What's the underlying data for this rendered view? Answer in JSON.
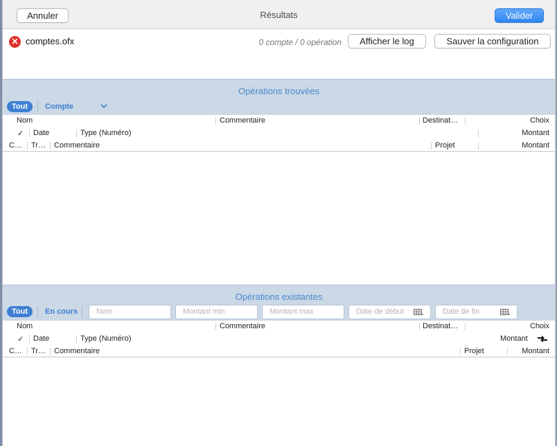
{
  "toolbar": {
    "cancel_label": "Annuler",
    "title": "Résultats",
    "validate_label": "Valider"
  },
  "file": {
    "name": "comptes.ofx",
    "status_icon": "error-icon",
    "count_text": "0 compte / 0 opération",
    "show_log_label": "Afficher le log",
    "save_config_label": "Sauver la configuration"
  },
  "found": {
    "title": "Opérations trouvées",
    "all_label": "Tout",
    "account_label": "Compte",
    "columns": {
      "row1": [
        "Nom",
        "Commentaire",
        "Destinat…",
        "Choix"
      ],
      "row2": [
        "✓",
        "Date",
        "Type (Numéro)",
        "Montant"
      ],
      "row3": [
        "C…",
        "Tr…",
        "Commentaire",
        "Projet",
        "Montant"
      ]
    }
  },
  "existing": {
    "title": "Opérations existantes",
    "all_label": "Tout",
    "current_label": "En cours",
    "filters": {
      "name_placeholder": "Nom",
      "min_placeholder": "Montant min",
      "max_placeholder": "Montant max",
      "start_placeholder": "Date de début",
      "end_placeholder": "Date de fin"
    },
    "columns": {
      "row1": [
        "Nom",
        "Commentaire",
        "Destinat…",
        "Choix"
      ],
      "row2": [
        "✓",
        "Date",
        "Type (Numéro)",
        "Montant"
      ],
      "row3": [
        "C…",
        "Tr…",
        "Commentaire",
        "Projet",
        "Montant"
      ]
    }
  },
  "colors": {
    "accent": "#3e7fd3",
    "section_bg": "#cbd8e6",
    "error": "#e0332d"
  }
}
